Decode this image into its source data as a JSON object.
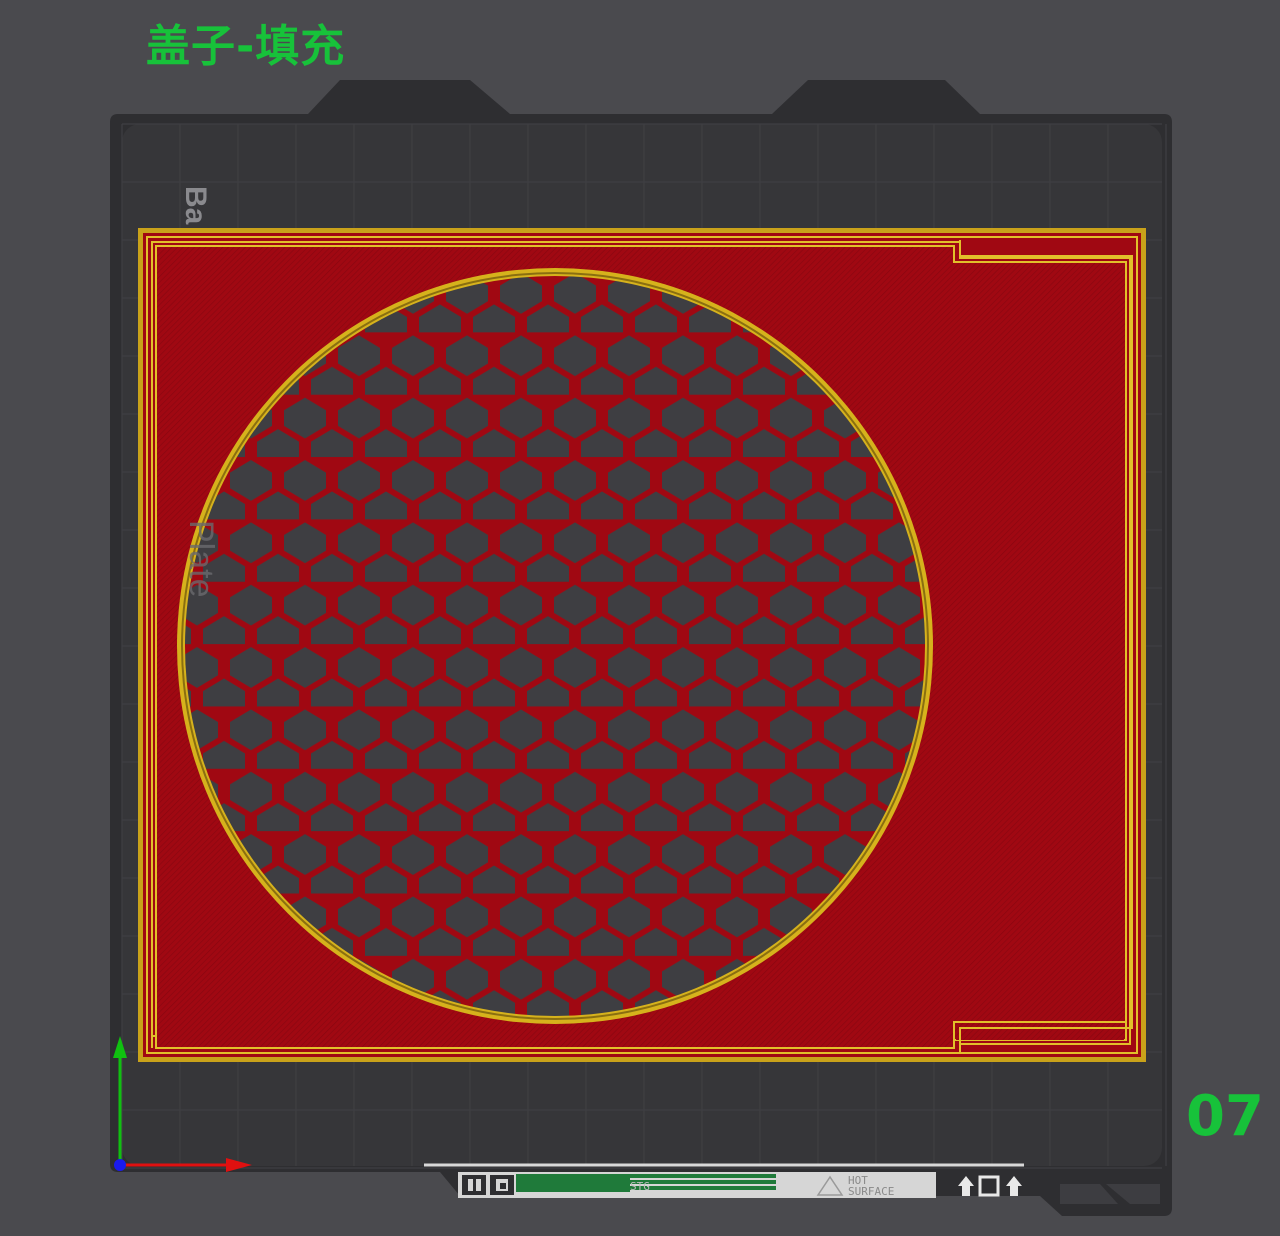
{
  "title": "盖子-填充",
  "plate_number": "07",
  "bed": {
    "watermark_top": "Ba",
    "watermark_side": "Plate"
  },
  "bed_label": {
    "hot_line1": "HOT",
    "hot_line2": "SURFACE",
    "mid_text": "STG"
  },
  "colors": {
    "background": "#4a4a4e",
    "bed": "#333336",
    "plate": "#2b2b2e",
    "fill_red": "#a00812",
    "wall_yellow": "#d6b21c",
    "label_green": "#17c23a",
    "axis_x": "#e01010",
    "axis_y": "#10c010"
  }
}
